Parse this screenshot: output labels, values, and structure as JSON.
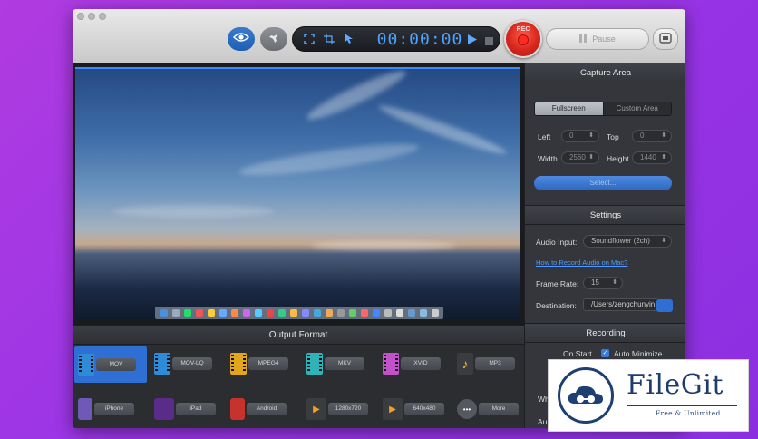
{
  "toolbar": {
    "timer": "00:00:00",
    "rec_label": "REC",
    "pause_label": "Pause"
  },
  "output_format": {
    "title": "Output Format",
    "formats": [
      {
        "label": "MOV",
        "color": "#2d8bd8"
      },
      {
        "label": "MOV-LQ",
        "color": "#2d8bd8"
      },
      {
        "label": "MPEG4",
        "color": "#e2a61d"
      },
      {
        "label": "MKV",
        "color": "#2fb3b8"
      },
      {
        "label": "XVID",
        "color": "#c152c9"
      },
      {
        "label": "MP3",
        "color": "#3a3c40"
      },
      {
        "label": "iPhone",
        "color": "#6e58b8"
      },
      {
        "label": "iPad",
        "color": "#5a2c8a"
      },
      {
        "label": "Android",
        "color": "#c8322c"
      },
      {
        "label": "1280x720",
        "color": "#3a3c40"
      },
      {
        "label": "640x480",
        "color": "#3a3c40"
      },
      {
        "label": "More",
        "color": "#3a3c40"
      }
    ],
    "selected": "MOV"
  },
  "capture_area": {
    "title": "Capture Area",
    "modes": [
      "Fullscreen",
      "Custom Area"
    ],
    "active_mode": "Fullscreen",
    "left_label": "Left",
    "left_value": "0",
    "top_label": "Top",
    "top_value": "0",
    "width_label": "Width",
    "width_value": "2560",
    "height_label": "Height",
    "height_value": "1440",
    "select_label": "Select..."
  },
  "settings": {
    "title": "Settings",
    "audio_input_label": "Audio Input:",
    "audio_input_value": "Soundflower (2ch)",
    "help_link": "How to Record Audio on Mac?",
    "frame_rate_label": "Frame Rate:",
    "frame_rate_value": "15",
    "destination_label": "Destination:",
    "destination_value": "/Users/zengchunyin"
  },
  "recording": {
    "title": "Recording",
    "on_start_label": "On Start",
    "auto_minimize_label": "Auto Minimize",
    "auto_minimize_checked": true,
    "row2_partial": "Wh",
    "row3_partial": "Au"
  },
  "badge": {
    "title": "FileGit",
    "subtitle": "Free & Unlimited"
  }
}
